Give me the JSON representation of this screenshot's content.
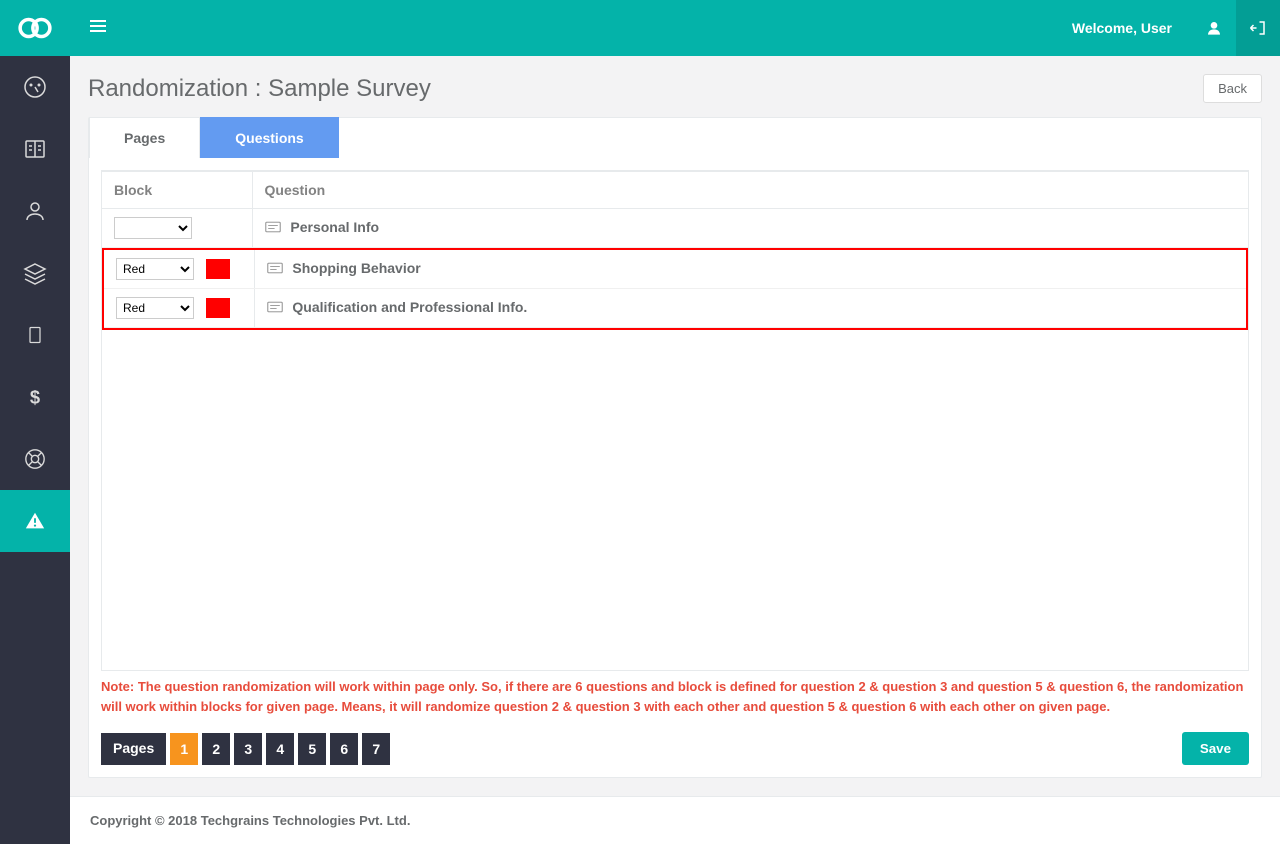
{
  "topbar": {
    "welcome": "Welcome, User"
  },
  "page": {
    "title": "Randomization : Sample Survey",
    "back": "Back"
  },
  "tabs": {
    "pages": "Pages",
    "questions": "Questions"
  },
  "table": {
    "headers": {
      "block": "Block",
      "question": "Question"
    },
    "rows": [
      {
        "block": "",
        "swatch": "",
        "question": "Personal Info"
      },
      {
        "block": "Red",
        "swatch": "red",
        "question": "Shopping Behavior"
      },
      {
        "block": "Red",
        "swatch": "red",
        "question": "Qualification and Professional Info."
      }
    ]
  },
  "note": "Note: The question randomization will work within page only. So, if there are 6 questions and block is defined for question 2 & question 3 and question 5 & question 6, the randomization will work within blocks for given page. Means, it will randomize question 2 & question 3 with each other and question 5 & question 6 with each other on given page.",
  "pager": {
    "label": "Pages",
    "pages": [
      "1",
      "2",
      "3",
      "4",
      "5",
      "6",
      "7"
    ],
    "active": "1"
  },
  "buttons": {
    "save": "Save"
  },
  "footer": "Copyright © 2018 Techgrains Technologies Pvt. Ltd."
}
